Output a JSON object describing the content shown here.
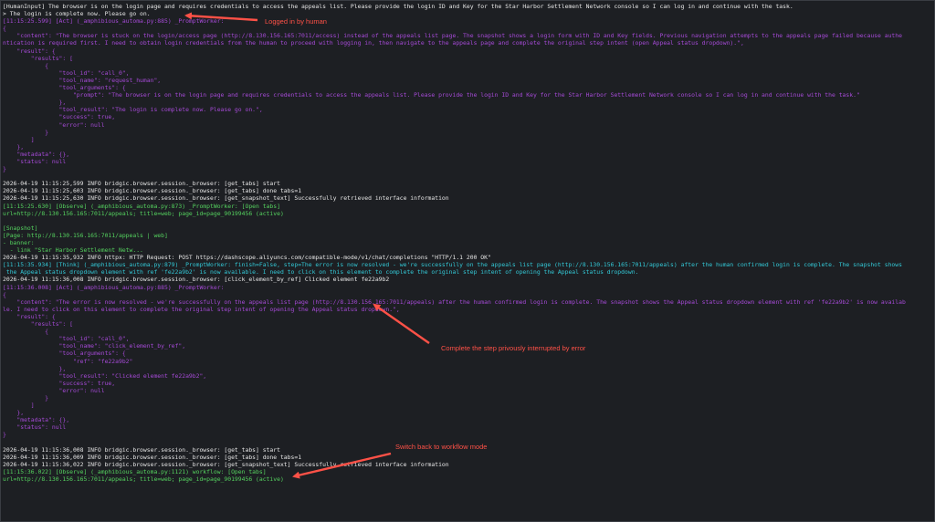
{
  "log_lines": [
    {
      "text": "[HumanInput] The browser is on the login page and requires credentials to access the appeals list. Please provide the login ID and Key for the Star Harbor Settlement Network console so I can log in and continue with the task.",
      "color": "w"
    },
    {
      "text": "> The login is complete now. Please go on.",
      "color": "w"
    },
    {
      "text": "[11:15:25.599] [Act] (_amphibious_automa.py:885) _PromptWorker:",
      "color": "p"
    },
    {
      "text": "{",
      "color": "p"
    },
    {
      "text": "    \"content\": \"The browser is stuck on the login/access page (http://8.130.156.165:7011/access) instead of the appeals list page. The snapshot shows a login form with ID and Key fields. Previous navigation attempts to the appeals page failed because authe",
      "color": "p"
    },
    {
      "text": "ntication is required first. I need to obtain login credentials from the human to proceed with logging in, then navigate to the appeals page and complete the original step intent (open Appeal status dropdown).\",",
      "color": "p"
    },
    {
      "text": "    \"result\": {",
      "color": "p"
    },
    {
      "text": "        \"results\": [",
      "color": "p"
    },
    {
      "text": "            {",
      "color": "p"
    },
    {
      "text": "                \"tool_id\": \"call_0\",",
      "color": "p"
    },
    {
      "text": "                \"tool_name\": \"request_human\",",
      "color": "p"
    },
    {
      "text": "                \"tool_arguments\": {",
      "color": "p"
    },
    {
      "text": "                    \"prompt\": \"The browser is on the login page and requires credentials to access the appeals list. Please provide the login ID and Key for the Star Harbor Settlement Network console so I can log in and continue with the task.\"",
      "color": "p"
    },
    {
      "text": "                },",
      "color": "p"
    },
    {
      "text": "                \"tool_result\": \"The login is complete now. Please go on.\",",
      "color": "p"
    },
    {
      "text": "                \"success\": true,",
      "color": "p"
    },
    {
      "text": "                \"error\": null",
      "color": "p"
    },
    {
      "text": "            }",
      "color": "p"
    },
    {
      "text": "        ]",
      "color": "p"
    },
    {
      "text": "    },",
      "color": "p"
    },
    {
      "text": "    \"metadata\": {},",
      "color": "p"
    },
    {
      "text": "    \"status\": null",
      "color": "p"
    },
    {
      "text": "}",
      "color": "p"
    },
    {
      "text": "",
      "color": "w"
    },
    {
      "text": "2026-04-19 11:15:25,599 INFO bridgic.browser.session._browser: [get_tabs] start",
      "color": "w"
    },
    {
      "text": "2026-04-19 11:15:25,603 INFO bridgic.browser.session._browser: [get_tabs] done tabs=1",
      "color": "w"
    },
    {
      "text": "2026-04-19 11:15:25,630 INFO bridgic.browser.session._browser: [get_snapshot_text] Successfully retrieved interface information",
      "color": "w"
    },
    {
      "text": "[11:15:25.630] [Observe] (_amphibious_automa.py:873) _PromptWorker: [Open tabs]",
      "color": "g"
    },
    {
      "text": "url=http://8.130.156.165:7011/appeals; title=web; page_id=page_90199456 (active)",
      "color": "g"
    },
    {
      "text": "",
      "color": "w"
    },
    {
      "text": "[Snapshot]",
      "color": "g"
    },
    {
      "text": "[Page: http://8.130.156.165:7011/appeals | web]",
      "color": "g"
    },
    {
      "text": "- banner:",
      "color": "g"
    },
    {
      "text": "  - link \"Star Harbor Settlement Netw...",
      "color": "g"
    },
    {
      "text": "2026-04-19 11:15:35,932 INFO httpx: HTTP Request: POST https://dashscope.aliyuncs.com/compatible-mode/v1/chat/completions \"HTTP/1.1 200 OK\"",
      "color": "w"
    },
    {
      "text": "[11:15:35.934] [Think] (_amphibious_automa.py:879) _PromptWorker: finish=False, step=The error is now resolved - we're successfully on the appeals list page (http://8.130.156.165:7011/appeals) after the human confirmed login is complete. The snapshot shows",
      "color": "c"
    },
    {
      "text": " the Appeal status dropdown element with ref 'fe22a9b2' is now available. I need to click on this element to complete the original step intent of opening the Appeal status dropdown.",
      "color": "c"
    },
    {
      "text": "2026-04-19 11:15:36,008 INFO bridgic.browser.session._browser: [click_element_by_ref] Clicked element fe22a9b2",
      "color": "w"
    },
    {
      "text": "[11:15:36.008] [Act] (_amphibious_automa.py:885) _PromptWorker:",
      "color": "p"
    },
    {
      "text": "{",
      "color": "p"
    },
    {
      "text": "    \"content\": \"The error is now resolved - we're successfully on the appeals list page (http://8.130.156.165:7011/appeals) after the human confirmed login is complete. The snapshot shows the Appeal status dropdown element with ref 'fe22a9b2' is now availab",
      "color": "p"
    },
    {
      "text": "le. I need to click on this element to complete the original step intent of opening the Appeal status dropdown.\",",
      "color": "p"
    },
    {
      "text": "    \"result\": {",
      "color": "p"
    },
    {
      "text": "        \"results\": [",
      "color": "p"
    },
    {
      "text": "            {",
      "color": "p"
    },
    {
      "text": "                \"tool_id\": \"call_0\",",
      "color": "p"
    },
    {
      "text": "                \"tool_name\": \"click_element_by_ref\",",
      "color": "p"
    },
    {
      "text": "                \"tool_arguments\": {",
      "color": "p"
    },
    {
      "text": "                    \"ref\": \"fe22a9b2\"",
      "color": "p"
    },
    {
      "text": "                },",
      "color": "p"
    },
    {
      "text": "                \"tool_result\": \"Clicked element fe22a9b2\",",
      "color": "p"
    },
    {
      "text": "                \"success\": true,",
      "color": "p"
    },
    {
      "text": "                \"error\": null",
      "color": "p"
    },
    {
      "text": "            }",
      "color": "p"
    },
    {
      "text": "        ]",
      "color": "p"
    },
    {
      "text": "    },",
      "color": "p"
    },
    {
      "text": "    \"metadata\": {},",
      "color": "p"
    },
    {
      "text": "    \"status\": null",
      "color": "p"
    },
    {
      "text": "}",
      "color": "p"
    },
    {
      "text": "",
      "color": "w"
    },
    {
      "text": "2026-04-19 11:15:36,008 INFO bridgic.browser.session._browser: [get_tabs] start",
      "color": "w"
    },
    {
      "text": "2026-04-19 11:15:36,009 INFO bridgic.browser.session._browser: [get_tabs] done tabs=1",
      "color": "w"
    },
    {
      "text": "2026-04-19 11:15:36,022 INFO bridgic.browser.session._browser: [get_snapshot_text] Successfully retrieved interface information",
      "color": "w"
    },
    {
      "text": "[11:15:36.022] [Observe] (_amphibious_automa.py:1121) workflow: [Open tabs]",
      "color": "g"
    },
    {
      "text": "url=http://8.130.156.165:7011/appeals; title=web; page_id=page_90199456 (active)",
      "color": "g"
    }
  ],
  "annotations": {
    "logged_in": "Logged in by human",
    "complete_step": "Complete the step privously interrupted by error",
    "workflow_mode": "Switch back to workflow mode"
  },
  "colors": {
    "background": "#1d1f23",
    "annotation": "#ff5147",
    "green": "#55d35f",
    "purple": "#a54ad6",
    "cyan": "#33c8d6"
  }
}
